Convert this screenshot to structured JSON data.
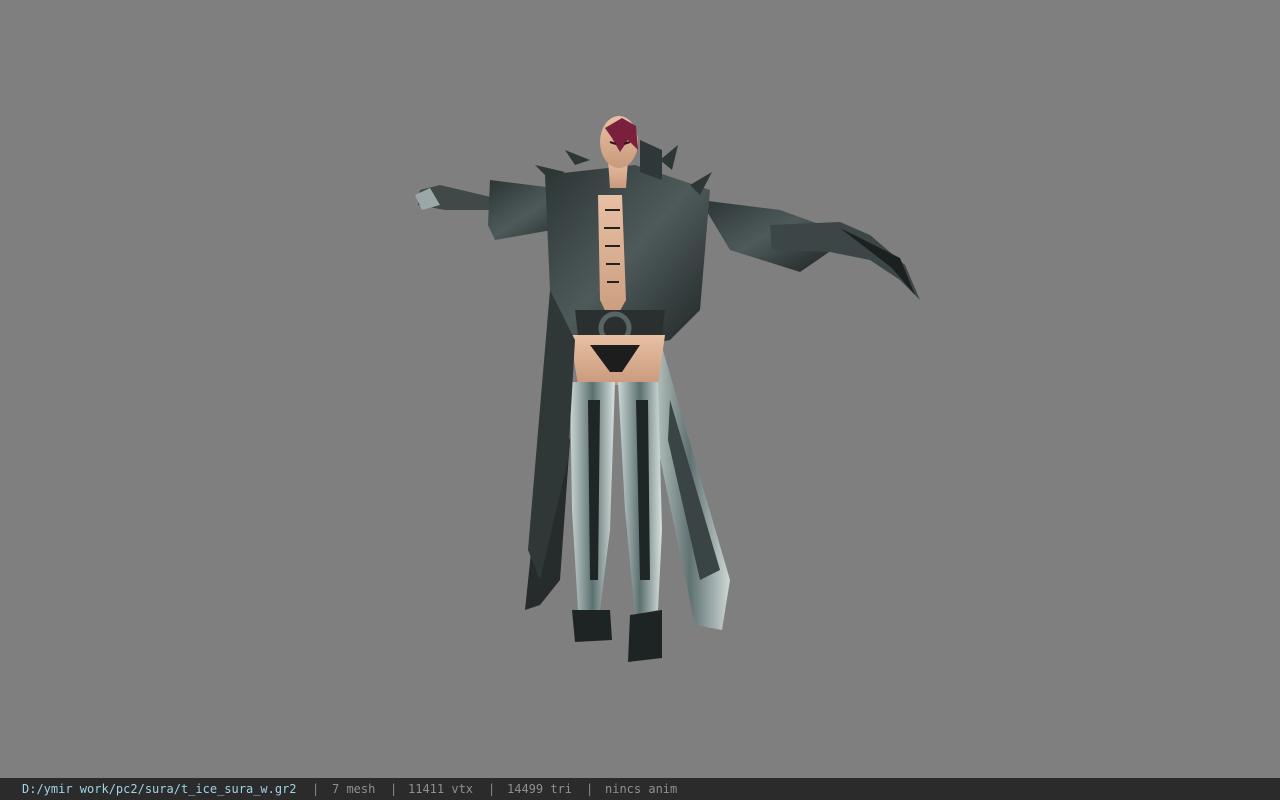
{
  "viewport": {
    "background": "#7f7f7f",
    "model_description_icon": "character-model-icon"
  },
  "statusbar": {
    "file_path": "D:/ymir work/pc2/sura/t_ice_sura_w.gr2",
    "separator": "|",
    "mesh": "7 mesh",
    "vtx": "11411 vtx",
    "tri": "14499 tri",
    "anim": "nincs anim",
    "path_color": "#9fd3e6",
    "bg_color": "#2b2b2b"
  }
}
